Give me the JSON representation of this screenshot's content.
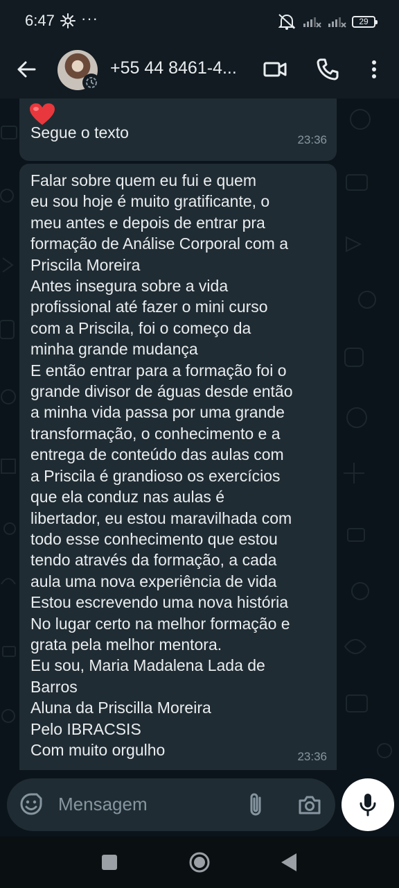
{
  "status_bar": {
    "time": "6:47",
    "more": "···",
    "battery": "29"
  },
  "header": {
    "back_icon": "arrow-left-icon",
    "contact_name": "+55 44 8461-4...",
    "video_icon": "video-camera-icon",
    "call_icon": "phone-icon",
    "menu_icon": "more-vertical-icon"
  },
  "messages": [
    {
      "emoji": "heart-icon",
      "text": "Segue o texto",
      "time": "23:36"
    },
    {
      "lines": [
        "Falar sobre quem eu fui e quem",
        "eu sou hoje é muito gratificante, o",
        "meu antes e depois de entrar pra",
        "formação de Análise Corporal com a",
        "Priscila Moreira",
        "Antes insegura sobre a vida",
        "profissional até fazer o mini curso",
        "com a Priscila, foi o começo da",
        "minha grande mudança",
        "E então entrar para a formação foi o",
        "grande divisor de águas desde então",
        "a minha vida passa por uma grande",
        "transformação, o conhecimento e a",
        "entrega de conteúdo das aulas com",
        "a Priscila é grandioso os exercícios",
        "que ela conduz nas aulas é",
        "libertador, eu estou maravilhada com",
        "todo esse conhecimento que estou",
        "tendo através da formação, a cada",
        "aula uma nova experiência de vida",
        "Estou escrevendo uma nova história",
        "No lugar certo na melhor formação e",
        "grata pela melhor mentora.",
        "Eu sou, Maria Madalena Lada de",
        "Barros",
        "Aluna da Priscilla Moreira",
        "Pelo IBRACSIS",
        "Com muito orgulho"
      ],
      "time": "23:36"
    }
  ],
  "composer": {
    "placeholder": "Mensagem",
    "emoji_icon": "emoji-smile-icon",
    "attach_icon": "paperclip-icon",
    "camera_icon": "camera-icon",
    "mic_icon": "microphone-icon"
  },
  "colors": {
    "background": "#0b141a",
    "bar": "#121b22",
    "bubble": "#202c33",
    "text": "#e9edef",
    "meta": "#8696a0"
  }
}
